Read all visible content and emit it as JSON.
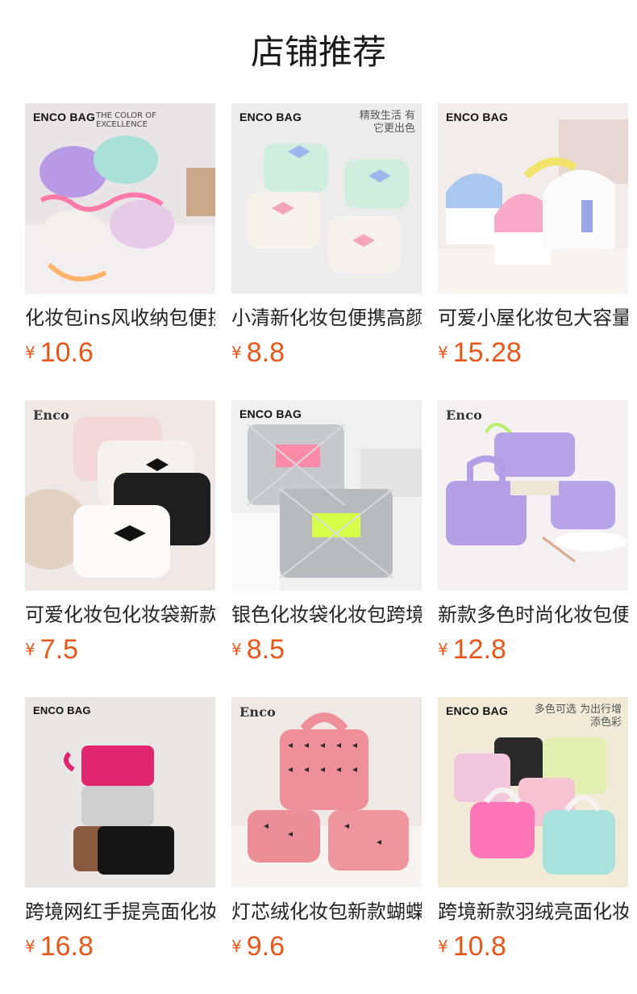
{
  "page_title": "店铺推荐",
  "currency_symbol": "¥",
  "products": [
    {
      "name": "化妆包ins风收纳包便携",
      "price": "10.6",
      "brand": "ENCO BAG",
      "brand_sub": "THE COLOR OF EXCELLENCE",
      "tag": ""
    },
    {
      "name": "小清新化妆包便携高颜值",
      "price": "8.8",
      "brand": "ENCO BAG",
      "brand_sub": "",
      "tag": "精致生活 有它更出色"
    },
    {
      "name": "可爱小屋化妆包大容量",
      "price": "15.28",
      "brand": "ENCO BAG",
      "brand_sub": "",
      "tag": ""
    },
    {
      "name": "可爱化妆包化妆袋新款",
      "price": "7.5",
      "brand": "Enco",
      "brand_sub": "",
      "tag": ""
    },
    {
      "name": "银色化妆袋化妆包跨境",
      "price": "8.5",
      "brand": "ENCO BAG",
      "brand_sub": "",
      "tag": ""
    },
    {
      "name": "新款多色时尚化妆包便携",
      "price": "12.8",
      "brand": "Enco",
      "brand_sub": "",
      "tag": ""
    },
    {
      "name": "跨境网红手提亮面化妆包",
      "price": "16.8",
      "brand": "ENCO BAG",
      "brand_sub": "",
      "tag": ""
    },
    {
      "name": "灯芯绒化妆包新款蝴蝶结",
      "price": "9.6",
      "brand": "Enco",
      "brand_sub": "",
      "tag": ""
    },
    {
      "name": "跨境新款羽绒亮面化妆包",
      "price": "10.8",
      "brand": "ENCO BAG",
      "brand_sub": "",
      "tag": "多色可选 为出行增添色彩"
    }
  ]
}
